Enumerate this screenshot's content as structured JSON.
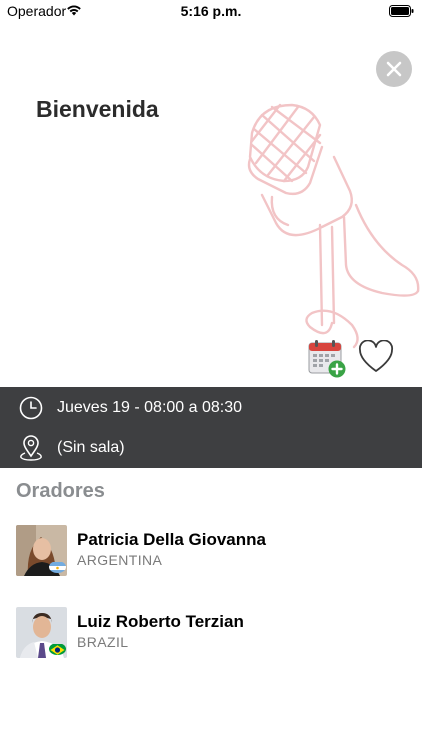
{
  "status_bar": {
    "carrier": "Operador",
    "time": "5:16 p.m."
  },
  "header": {
    "title": "Bienvenida",
    "close_icon": "close-icon"
  },
  "actions": {
    "calendar_icon": "calendar-add-icon",
    "favorite_icon": "heart-outline-icon"
  },
  "session": {
    "time": "Jueves 19 - 08:00 a 08:30",
    "location": "(Sin sala)"
  },
  "speakers_section": {
    "title": "Oradores",
    "speakers": [
      {
        "name": "Patricia Della Giovanna",
        "country": "ARGENTINA",
        "flag": "argentina-flag"
      },
      {
        "name": "Luiz Roberto Terzian",
        "country": "BRAZIL",
        "flag": "brazil-flag"
      }
    ]
  },
  "colors": {
    "info_bar": "#3e3f41",
    "accent_pink": "#f2c4c6",
    "section_title": "#8a8d90"
  }
}
